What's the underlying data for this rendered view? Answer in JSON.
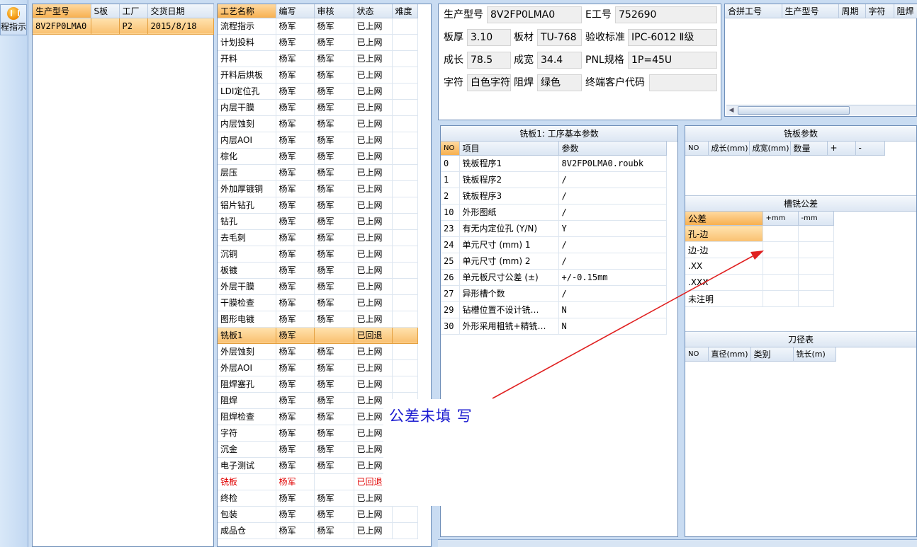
{
  "nav": {
    "label": "程指示"
  },
  "orders": {
    "headers": [
      "生产型号",
      "S板",
      "工厂",
      "交货日期"
    ],
    "rows": [
      [
        "8V2FP0LMA0",
        "",
        "P2",
        "2015/8/18"
      ]
    ]
  },
  "process": {
    "headers": [
      "工艺名称",
      "编写",
      "审核",
      "状态",
      "难度"
    ],
    "rows": [
      [
        "流程指示",
        "杨军",
        "杨军",
        "已上网",
        ""
      ],
      [
        "计划投料",
        "杨军",
        "杨军",
        "已上网",
        ""
      ],
      [
        "开料",
        "杨军",
        "杨军",
        "已上网",
        ""
      ],
      [
        "开料后烘板",
        "杨军",
        "杨军",
        "已上网",
        ""
      ],
      [
        "LDI定位孔",
        "杨军",
        "杨军",
        "已上网",
        ""
      ],
      [
        "内层干膜",
        "杨军",
        "杨军",
        "已上网",
        ""
      ],
      [
        "内层蚀刻",
        "杨军",
        "杨军",
        "已上网",
        ""
      ],
      [
        "内层AOI",
        "杨军",
        "杨军",
        "已上网",
        ""
      ],
      [
        "棕化",
        "杨军",
        "杨军",
        "已上网",
        ""
      ],
      [
        "层压",
        "杨军",
        "杨军",
        "已上网",
        ""
      ],
      [
        "外加厚镀铜",
        "杨军",
        "杨军",
        "已上网",
        ""
      ],
      [
        "铝片钻孔",
        "杨军",
        "杨军",
        "已上网",
        ""
      ],
      [
        "钻孔",
        "杨军",
        "杨军",
        "已上网",
        ""
      ],
      [
        "去毛刺",
        "杨军",
        "杨军",
        "已上网",
        ""
      ],
      [
        "沉铜",
        "杨军",
        "杨军",
        "已上网",
        ""
      ],
      [
        "板镀",
        "杨军",
        "杨军",
        "已上网",
        ""
      ],
      [
        "外层干膜",
        "杨军",
        "杨军",
        "已上网",
        ""
      ],
      [
        "干膜检查",
        "杨军",
        "杨军",
        "已上网",
        ""
      ],
      [
        "图形电镀",
        "杨军",
        "杨军",
        "已上网",
        ""
      ],
      [
        "铣板1",
        "杨军",
        "",
        "已回退",
        ""
      ],
      [
        "外层蚀刻",
        "杨军",
        "杨军",
        "已上网",
        ""
      ],
      [
        "外层AOI",
        "杨军",
        "杨军",
        "已上网",
        ""
      ],
      [
        "阻焊塞孔",
        "杨军",
        "杨军",
        "已上网",
        ""
      ],
      [
        "阻焊",
        "杨军",
        "杨军",
        "已上网",
        ""
      ],
      [
        "阻焊检查",
        "杨军",
        "杨军",
        "已上网",
        ""
      ],
      [
        "字符",
        "杨军",
        "杨军",
        "已上网",
        ""
      ],
      [
        "沉金",
        "杨军",
        "杨军",
        "已上网",
        ""
      ],
      [
        "电子测试",
        "杨军",
        "杨军",
        "已上网",
        ""
      ],
      [
        "铣板",
        "杨军",
        "",
        "已回退",
        ""
      ],
      [
        "终检",
        "杨军",
        "杨军",
        "已上网",
        ""
      ],
      [
        "包装",
        "杨军",
        "杨军",
        "已上网",
        ""
      ],
      [
        "成品仓",
        "杨军",
        "杨军",
        "已上网",
        ""
      ]
    ]
  },
  "info": {
    "model_label": "生产型号",
    "model_value": "8V2FP0LMA0",
    "e_label": "E工号",
    "e_value": "752690",
    "thick_label": "板厚",
    "thick_value": "3.10",
    "material_label": "板材",
    "material_value": "TU-768",
    "std_label": "验收标准",
    "std_value": "IPC-6012 Ⅱ级",
    "len_label": "成长",
    "len_value": "78.5",
    "wid_label": "成宽",
    "wid_value": "34.4",
    "pnl_label": "PNL规格",
    "pnl_value": "1P=45U",
    "char_label": "字符",
    "char_value": "白色字符",
    "mask_label": "阻焊",
    "mask_value": "绿色",
    "cust_label": "终端客户代码",
    "cust_value": ""
  },
  "combine": {
    "headers": [
      "合拼工号",
      "生产型号",
      "周期",
      "字符",
      "阻焊"
    ]
  },
  "basic": {
    "title": "铣板1: 工序基本参数",
    "headers": [
      "NO",
      "项目",
      "参数"
    ],
    "rows": [
      [
        "0",
        "铣板程序1",
        "8V2FP0LMA0.roubk"
      ],
      [
        "1",
        "铣板程序2",
        "/"
      ],
      [
        "2",
        "铣板程序3",
        "/"
      ],
      [
        "10",
        "外形图纸",
        "/"
      ],
      [
        "23",
        "有无内定位孔 (Y/N)",
        "Y"
      ],
      [
        "24",
        "单元尺寸 (mm) 1",
        "/"
      ],
      [
        "25",
        "单元尺寸 (mm) 2",
        "/"
      ],
      [
        "26",
        "单元板尺寸公差 (±)",
        "+/-0.15mm"
      ],
      [
        "27",
        "异形槽个数",
        "/"
      ],
      [
        "29",
        "钻槽位置不设计铣…",
        "N"
      ],
      [
        "30",
        "外形采用粗铣+精铣…",
        "N"
      ]
    ]
  },
  "mill": {
    "title": "铣板参数",
    "headers": [
      "NO",
      "成长(mm)",
      "成宽(mm)",
      "数量",
      "+",
      "-"
    ]
  },
  "tolerance": {
    "title": "槽铣公差",
    "headers": [
      "公差",
      "+mm",
      "-mm"
    ],
    "rows": [
      [
        "孔-边",
        "",
        ""
      ],
      [
        "边-边",
        "",
        ""
      ],
      [
        ".XX",
        "",
        ""
      ],
      [
        ".XXX",
        "",
        ""
      ],
      [
        "未注明",
        "",
        ""
      ]
    ]
  },
  "knife": {
    "title": "刀径表",
    "headers": [
      "NO",
      "直径(mm)",
      "类别",
      "铣长(m)"
    ]
  },
  "annotation": {
    "text": "公差未填 写"
  },
  "colors": {
    "arrow": "#e02020",
    "selected": "#f9c070",
    "reverted": "#e00000"
  }
}
